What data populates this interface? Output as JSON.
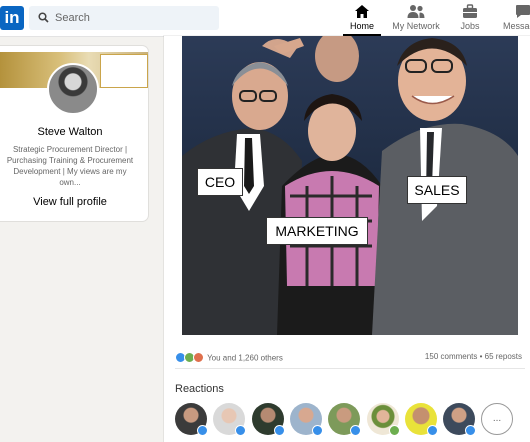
{
  "nav": {
    "logo": "in",
    "search_placeholder": "Search",
    "items": [
      {
        "label": "Home",
        "icon": "home-icon",
        "active": true
      },
      {
        "label": "My Network",
        "icon": "network-icon",
        "active": false
      },
      {
        "label": "Jobs",
        "icon": "briefcase-icon",
        "active": false
      },
      {
        "label": "Messag",
        "icon": "messaging-icon",
        "active": false
      }
    ]
  },
  "profile": {
    "name": "Steve Walton",
    "headline": "Strategic Procurement Director | Purchasing Training & Procurement Development | My views are my own...",
    "view_link": "View full profile"
  },
  "post": {
    "image_labels": {
      "ceo": "CEO",
      "sales": "SALES",
      "marketing": "MARKETING"
    },
    "reaction_summary": "You and 1,260 others",
    "counts": "150 comments • 65 reposts",
    "reactions_title": "Reactions",
    "more_label": "..."
  },
  "colors": {
    "brand": "#0a66c2",
    "like": "#378fe9",
    "celebrate": "#6dae4f",
    "love": "#df704d"
  }
}
